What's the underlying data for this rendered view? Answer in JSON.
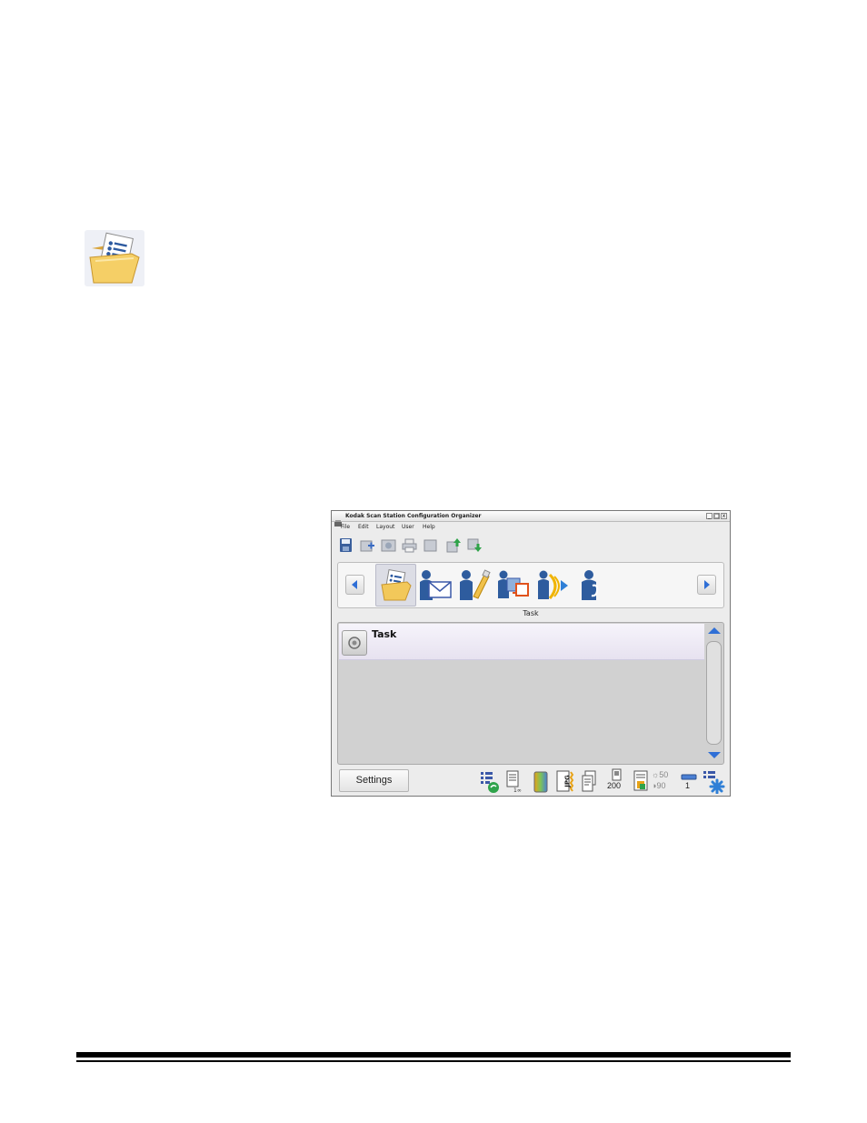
{
  "page_icon": "task-folder-icon",
  "window": {
    "title": "Kodak Scan Station Configuration Organizer",
    "app_icon": "scanner-icon",
    "controls": {
      "minimize": "_",
      "maximize": "□",
      "close": "x"
    },
    "menu": [
      "File",
      "Edit",
      "Layout",
      "User",
      "Help"
    ],
    "toolbar_icons": [
      "save-icon",
      "new-configuration-icon",
      "preview-icon",
      "print-icon",
      "delete-icon",
      "export-icon",
      "import-icon"
    ]
  },
  "task_strip": {
    "tiles": [
      {
        "icon": "task-folder-icon",
        "selected": true
      },
      {
        "icon": "email-user-icon"
      },
      {
        "icon": "usb-user-icon"
      },
      {
        "icon": "printer-user-icon"
      },
      {
        "icon": "fax-user-icon"
      },
      {
        "icon": "phone-user-icon"
      }
    ],
    "caption": "Task"
  },
  "list": {
    "rows": [
      {
        "label": "Task"
      }
    ]
  },
  "status_bar": {
    "settings_label": "Settings",
    "resolution": "200",
    "brightness": "50",
    "contrast": "90",
    "copies": "1"
  },
  "colors": {
    "window_bg": "#ececec",
    "panel_bg": "#d1d1d1",
    "row_bg": "#efebf6",
    "accent_blue": "#2f6fd6",
    "folder_yellow": "#f2c85a"
  }
}
